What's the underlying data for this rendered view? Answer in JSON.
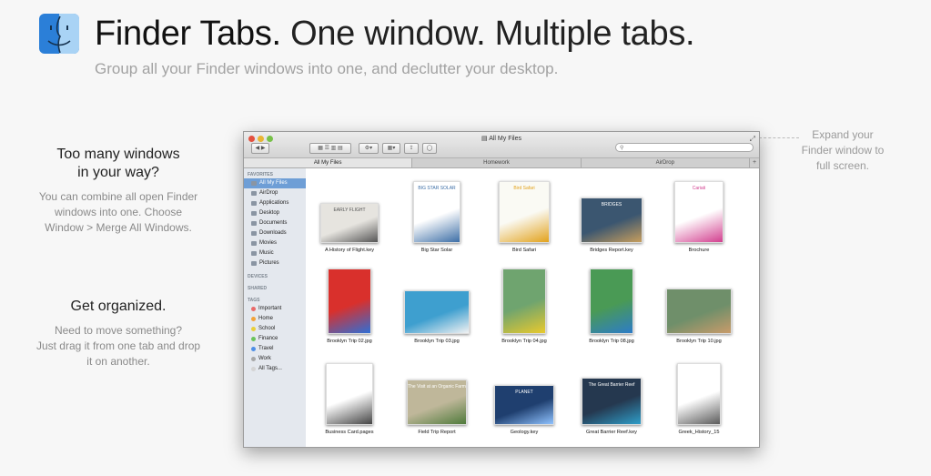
{
  "header": {
    "title_bold": "Finder Tabs.",
    "title_rest": "One window. Multiple tabs.",
    "subtitle": "Group all your Finder windows into one, and declutter your desktop."
  },
  "left": {
    "block1_title_line1": "Too many windows",
    "block1_title_line2": "in your way?",
    "block1_body_line1": "You can combine all open Finder",
    "block1_body_line2": "windows into one. Choose",
    "block1_body_line3": "Window > Merge All Windows.",
    "block2_title": "Get organized.",
    "block2_body_line1": "Need to move something?",
    "block2_body_line2": "Just drag it from one tab and drop",
    "block2_body_line3": "it on another."
  },
  "callout": {
    "line1": "Expand your",
    "line2": "Finder window to",
    "line3": "full screen."
  },
  "window": {
    "title": "All My Files",
    "tabs": [
      "All My Files",
      "Homework",
      "AirDrop"
    ],
    "add_tab": "+",
    "search_placeholder": "",
    "sidebar": {
      "favorites_header": "FAVORITES",
      "favorites": [
        "All My Files",
        "AirDrop",
        "Applications",
        "Desktop",
        "Documents",
        "Downloads",
        "Movies",
        "Music",
        "Pictures"
      ],
      "devices_header": "DEVICES",
      "shared_header": "SHARED",
      "tags_header": "TAGS",
      "tags": [
        {
          "label": "Important",
          "color": "#e96a6a"
        },
        {
          "label": "Home",
          "color": "#f2a33a"
        },
        {
          "label": "School",
          "color": "#e9cf3b"
        },
        {
          "label": "Finance",
          "color": "#6bc45b"
        },
        {
          "label": "Travel",
          "color": "#4f8fe6"
        },
        {
          "label": "Work",
          "color": "#a7a7a7"
        },
        {
          "label": "All Tags...",
          "color": "#d4d4d4"
        }
      ]
    },
    "files": [
      {
        "name": "A History of Flight.key",
        "thumb": "#e6e4df",
        "accent": "#555555",
        "text": "EARLY FLIGHT"
      },
      {
        "name": "Big Star Solar",
        "thumb": "#ffffff",
        "accent": "#3c6ea6",
        "text": "BIG STAR SOLAR"
      },
      {
        "name": "Bird Safari",
        "thumb": "#fafaf4",
        "accent": "#e2a21c",
        "text": "Bird Safari"
      },
      {
        "name": "Bridges Report.key",
        "thumb": "#3b5670",
        "accent": "#c79e5d",
        "text": "BRIDGES"
      },
      {
        "name": "Brochure",
        "thumb": "#ffffff",
        "accent": "#d23f8f",
        "text": "Cariati"
      },
      {
        "name": "Brooklyn Trip 02.jpg",
        "thumb": "#d9302c",
        "accent": "#2f6fd6",
        "text": ""
      },
      {
        "name": "Brooklyn Trip 03.jpg",
        "thumb": "#3e9fcf",
        "accent": "#f2f2f2",
        "text": ""
      },
      {
        "name": "Brooklyn Trip 04.jpg",
        "thumb": "#6fa46f",
        "accent": "#e9c92d",
        "text": ""
      },
      {
        "name": "Brooklyn Trip 08.jpg",
        "thumb": "#4a9a55",
        "accent": "#2d7cc8",
        "text": ""
      },
      {
        "name": "Brooklyn Trip 10.jpg",
        "thumb": "#6f8f6a",
        "accent": "#c99b6a",
        "text": ""
      },
      {
        "name": "Business Card.pages",
        "thumb": "#ffffff",
        "accent": "#444444",
        "text": ""
      },
      {
        "name": "Field Trip Report",
        "thumb": "#bfb79a",
        "accent": "#4f7a3b",
        "text": "The Visit at an Organic Farm"
      },
      {
        "name": "Geology.key",
        "thumb": "#1f3f6f",
        "accent": "#8fc2ff",
        "text": "PLANET"
      },
      {
        "name": "Great Barrier Reef.key",
        "thumb": "#25384f",
        "accent": "#2f9ec9",
        "text": "The Great Barrier Reef"
      },
      {
        "name": "Greek_History_15",
        "thumb": "#ffffff",
        "accent": "#5a5a5a",
        "text": ""
      }
    ]
  }
}
